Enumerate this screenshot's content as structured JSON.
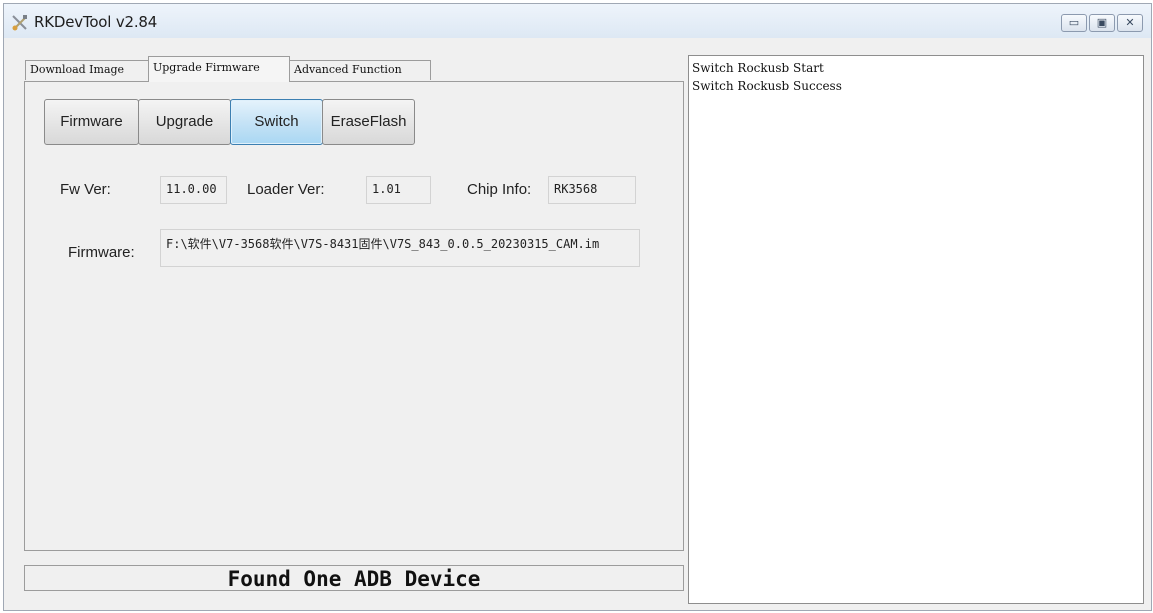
{
  "window": {
    "title": "RKDevTool v2.84",
    "controls": {
      "minimize": "▭",
      "maximize": "▣",
      "close": "✕"
    }
  },
  "tabs": [
    {
      "label": "Download Image",
      "active": false
    },
    {
      "label": "Upgrade Firmware",
      "active": true
    },
    {
      "label": "Advanced Function",
      "active": false
    }
  ],
  "toolbar": {
    "firmware_label": "Firmware",
    "upgrade_label": "Upgrade",
    "switch_label": "Switch",
    "eraseflash_label": "EraseFlash"
  },
  "info": {
    "fw_ver_label": "Fw Ver:",
    "fw_ver_value": "11.0.00",
    "loader_ver_label": "Loader Ver:",
    "loader_ver_value": "1.01",
    "chip_info_label": "Chip Info:",
    "chip_info_value": "RK3568",
    "firmware_label": "Firmware:",
    "firmware_path": "F:\\软件\\V7-3568软件\\V7S-8431固件\\V7S_843_0.0.5_20230315_CAM.im"
  },
  "status": {
    "text": "Found One ADB Device"
  },
  "log": {
    "lines": [
      "Switch Rockusb Start",
      "Switch Rockusb Success"
    ]
  },
  "colors": {
    "focused_button": "#c6e3f6",
    "window_bg": "#f0f0f0"
  }
}
